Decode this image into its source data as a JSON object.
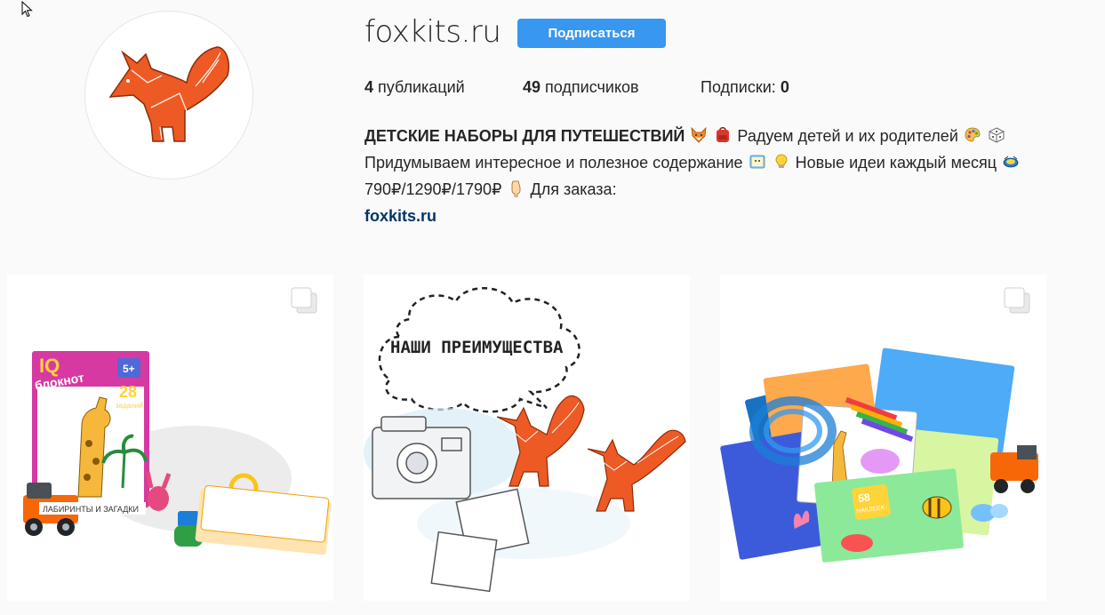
{
  "profile": {
    "username": "foxkits.ru",
    "follow_label": "Подписаться",
    "avatar_icon": "fox-logo-icon"
  },
  "stats": {
    "posts_count": "4",
    "posts_label": "публикаций",
    "followers_count": "49",
    "followers_label": "подписчиков",
    "following_label": "Подписки:",
    "following_count": "0"
  },
  "bio": {
    "name": "ДЕТСКИЕ НАБОРЫ ДЛЯ ПУТЕШЕСТВИЙ",
    "text1": "Радуем детей и их родителей",
    "text2": "Придумываем интересное и полезное содержание",
    "text3": "Новые идеи каждый месяц",
    "text4": "790₽/1290₽/1790₽",
    "text5": "Для заказа:",
    "link": "foxkits.ru"
  },
  "posts": [
    {
      "label": "IQ блокнот",
      "badge": "5+",
      "count": "28",
      "count_label": "заданий",
      "bottom_text": "ЛАБИРИНТЫ И ЗАГАДКИ",
      "icon": "multiple-photos-icon"
    },
    {
      "cloud_text": "НАШИ ПРЕИМУЩЕСТВА"
    },
    {
      "sticker_count": "58",
      "sticker_label": "НАКЛЕЕК",
      "icon": "multiple-photos-icon"
    }
  ],
  "colors": {
    "accent": "#3897f0",
    "fox": "#ee5a24",
    "link": "#003569"
  }
}
